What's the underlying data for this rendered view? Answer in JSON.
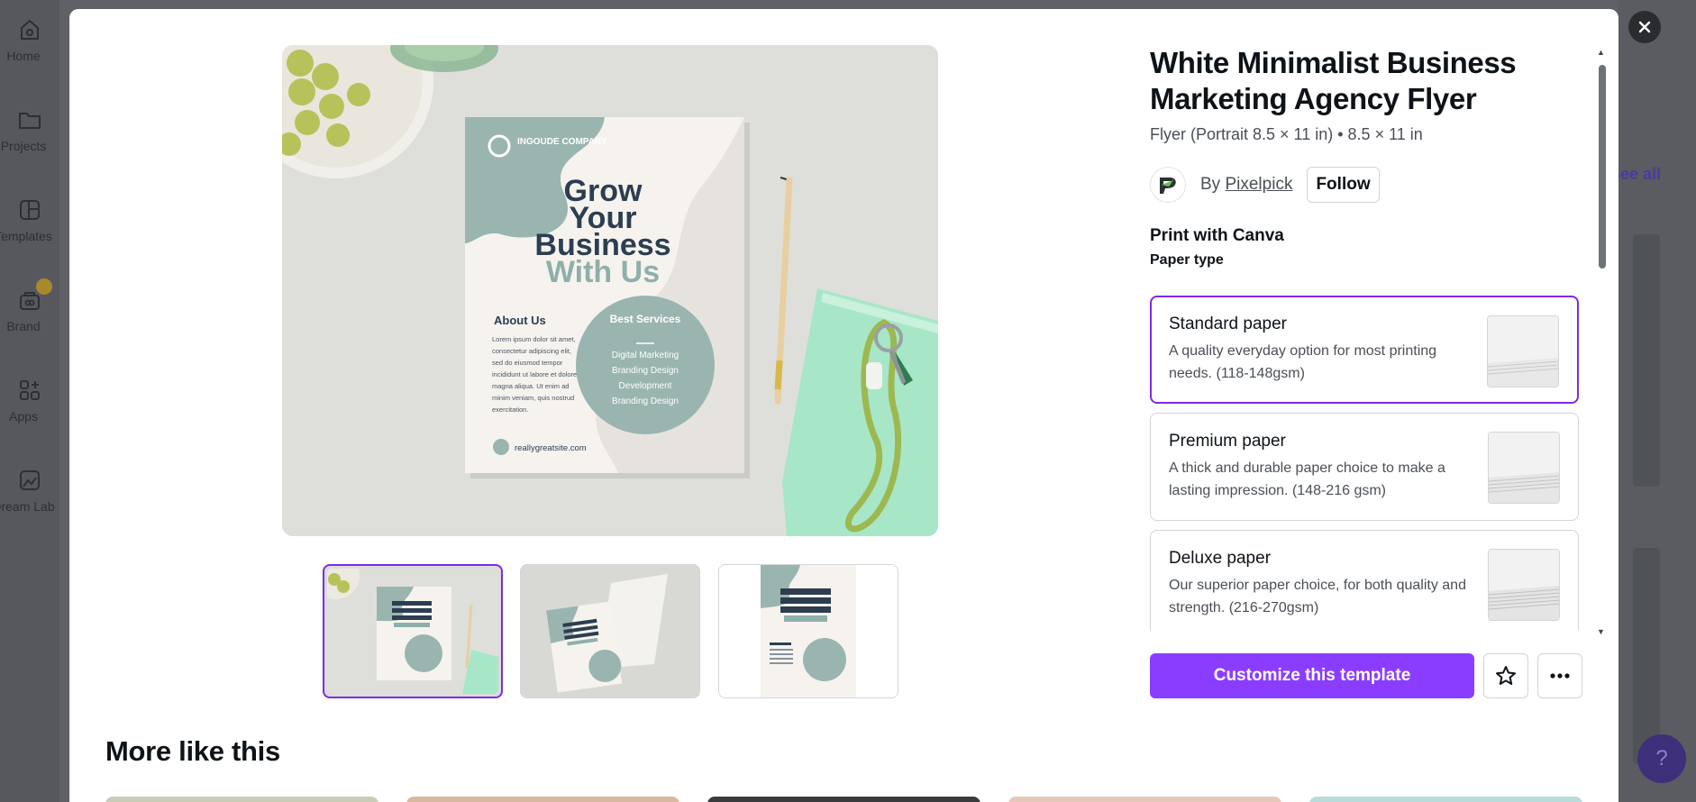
{
  "sidebar": {
    "items": [
      {
        "label": "Home",
        "icon": "home-icon"
      },
      {
        "label": "Projects",
        "icon": "folder-icon"
      },
      {
        "label": "Templates",
        "icon": "templates-icon"
      },
      {
        "label": "Brand",
        "icon": "brand-icon"
      },
      {
        "label": "Apps",
        "icon": "apps-icon"
      },
      {
        "label": "Dream Lab",
        "icon": "dream-lab-icon"
      }
    ]
  },
  "background": {
    "see_all": "See all",
    "help": "?"
  },
  "template": {
    "title": "White Minimalist Business Marketing Agency Flyer",
    "subtitle": "Flyer (Portrait 8.5 × 11 in) • 8.5 × 11 in",
    "by_label": "By",
    "author": "Pixelpick",
    "follow_label": "Follow"
  },
  "flyer": {
    "company": "INGOUDE COMPANY",
    "headline": [
      "Grow",
      "Your",
      "Business"
    ],
    "headline_accent": "With Us",
    "about_title": "About Us",
    "about_text": "Lorem ipsum dolor sit amet, consectetur adipiscing elit, sed do eiusmod tempor incididunt ut labore et dolore magna aliqua. Ut enim ad minim veniam, quis nostrud exercitation.",
    "services_title": "Best Services",
    "services": [
      "Digital Marketing",
      "Branding Design",
      "Development",
      "Branding Design"
    ],
    "website": "reallygreatsite.com"
  },
  "print": {
    "heading": "Print with Canva",
    "paper_type_label": "Paper type",
    "options": [
      {
        "name": "Standard paper",
        "desc": "A quality everyday option for most printing needs. (118-148gsm)",
        "selected": true
      },
      {
        "name": "Premium paper",
        "desc": "A thick and durable paper choice to make a lasting impression. (148-216 gsm)",
        "selected": false
      },
      {
        "name": "Deluxe paper",
        "desc": "Our superior paper choice, for both quality and strength. (216-270gsm)",
        "selected": false
      }
    ]
  },
  "actions": {
    "customize_label": "Customize this template"
  },
  "more": {
    "title": "More like this"
  },
  "colors": {
    "accent": "#8b3dff",
    "selected_border": "#7d2ae8",
    "flyer_teal": "#9ab5b0",
    "flyer_dark": "#2c3e50"
  }
}
